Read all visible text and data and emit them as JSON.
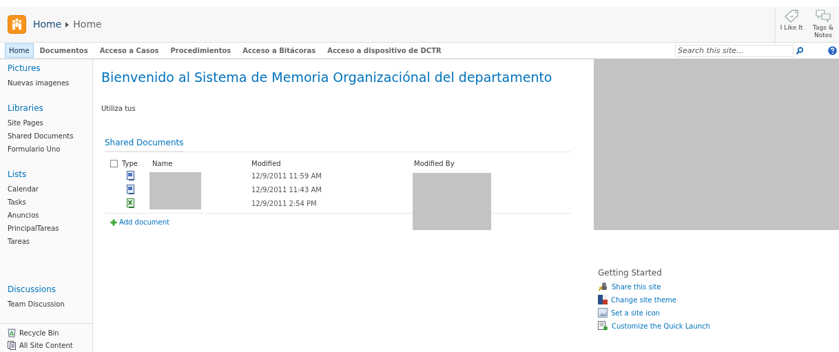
{
  "header": {
    "breadcrumb": [
      "Home",
      "Home"
    ],
    "actions": [
      {
        "kind": "like",
        "label": "I Like It"
      },
      {
        "kind": "tags",
        "label": "Tags & Notes"
      }
    ]
  },
  "nav": {
    "tabs": [
      {
        "label": "Home",
        "selected": true
      },
      {
        "label": "Documentos",
        "selected": false
      },
      {
        "label": "Acceso a Casos",
        "selected": false
      },
      {
        "label": "Procedimientos",
        "selected": false
      },
      {
        "label": "Acceso a Bitácoras",
        "selected": false
      },
      {
        "label": "Acceso a dispositivo de DCTR",
        "selected": false
      }
    ],
    "search": {
      "placeholder": "Search this site..."
    }
  },
  "sidebar": {
    "groups": [
      {
        "heading": "Pictures",
        "items": [
          "Nuevas imagenes"
        ]
      },
      {
        "heading": "Libraries",
        "items": [
          "Site Pages",
          "Shared Documents",
          "Formulario Uno"
        ]
      },
      {
        "heading": "Lists",
        "items": [
          "Calendar",
          "Tasks",
          "Anuncios",
          "PrincipalTareas",
          "Tareas"
        ]
      },
      {
        "heading": "Discussions",
        "items": [
          "Team Discussion"
        ]
      }
    ],
    "footer": [
      {
        "kind": "recycle",
        "label": "Recycle Bin"
      },
      {
        "kind": "content",
        "label": "All Site Content"
      }
    ]
  },
  "main": {
    "title": "Bienvenido al Sistema de Memoria Organizaciónal del departamento",
    "intro": "Utiliza tus",
    "library": {
      "title": "Shared Documents",
      "select_all": {
        "checked": false
      },
      "columns": [
        "Type",
        "Name",
        "Modified",
        "Modified By"
      ],
      "rows": [
        {
          "kind": "word",
          "modified": "12/9/2011 11:59 AM"
        },
        {
          "kind": "word",
          "modified": "12/9/2011 11:43 AM"
        },
        {
          "kind": "excel",
          "modified": "12/9/2011 2:54 PM"
        }
      ],
      "add": "Add document"
    }
  },
  "getting_started": {
    "title": "Getting Started",
    "links": [
      {
        "kind": "share",
        "label": "Share this site"
      },
      {
        "kind": "theme",
        "label": "Change site theme"
      },
      {
        "kind": "icon",
        "label": "Set a site icon"
      },
      {
        "kind": "launch",
        "label": "Customize the Quick Launch"
      }
    ]
  }
}
